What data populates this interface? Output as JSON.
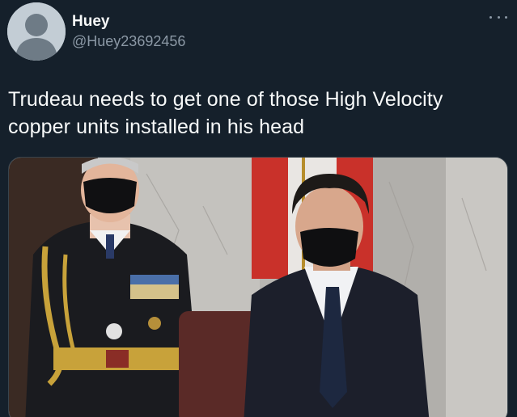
{
  "tweet": {
    "author": {
      "display_name": "Huey",
      "handle": "@Huey23692456",
      "avatar_icon": "default-avatar-icon"
    },
    "more_icon": "more-options-icon",
    "text": "Trudeau needs to get one of those High Velocity copper units installed in his head",
    "media": {
      "type": "photo",
      "icon": "tweet-photo"
    }
  },
  "colors": {
    "background": "#15202b",
    "text_primary": "#f7f9f9",
    "text_secondary": "#8b98a5",
    "border": "#38444d"
  }
}
